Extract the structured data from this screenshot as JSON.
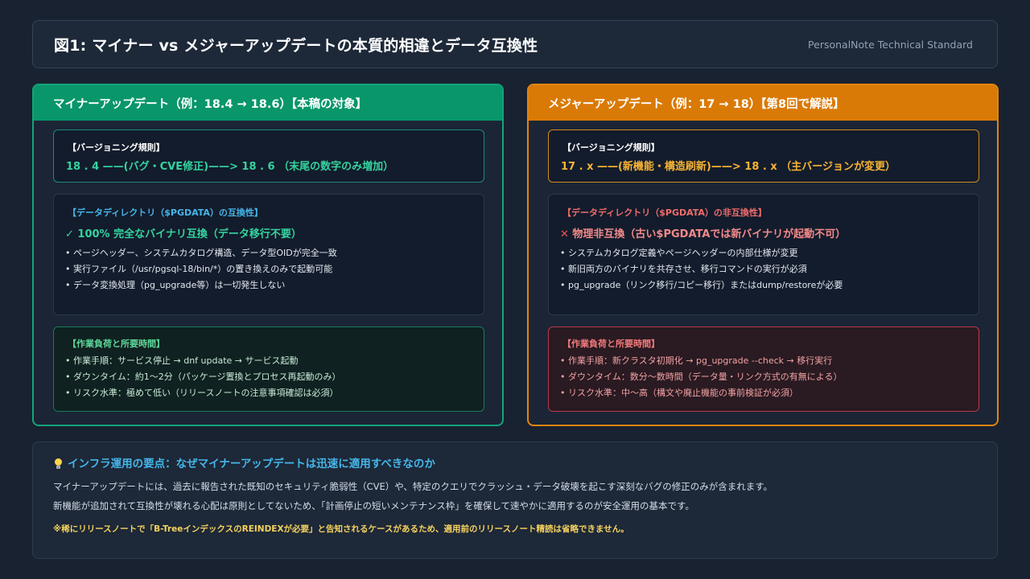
{
  "header": {
    "title": "図1: マイナー vs メジャーアップデートの本質的相違とデータ互換性",
    "subtitle": "PersonalNote Technical Standard"
  },
  "minor": {
    "heading": "マイナーアップデート（例：18.4 → 18.6）【本稿の対象】",
    "rule_label": "【バージョニング規則】",
    "rule_formula": "18 . 4 ——(バグ・CVE修正)——> 18 . 6 （末尾の数字のみ増加）",
    "compat_label": "【データディレクトリ（$PGDATA）の互換性】",
    "compat_verdict": "100% 完全なバイナリ互換（データ移行不要）",
    "compat_items": [
      "ページヘッダー、システムカタログ構造、データ型OIDが完全一致",
      "実行ファイル（/usr/pgsql-18/bin/*）の置き換えのみで起動可能",
      "データ変換処理（pg_upgrade等）は一切発生しない"
    ],
    "effort_label": "【作業負荷と所要時間】",
    "effort_items": [
      "作業手順：サービス停止 → dnf update → サービス起動",
      "ダウンタイム：約1〜2分（パッケージ置換とプロセス再起動のみ）",
      "リスク水準：極めて低い（リリースノートの注意事項確認は必須）"
    ]
  },
  "major": {
    "heading": "メジャーアップデート（例：17 → 18）【第8回で解説】",
    "rule_label": "【バージョニング規則】",
    "rule_formula": "17 . x ——(新機能・構造刷新)——> 18 . x （主バージョンが変更）",
    "compat_label": "【データディレクトリ（$PGDATA）の非互換性】",
    "compat_verdict": "物理非互換（古い$PGDATAでは新バイナリが起動不可）",
    "compat_items": [
      "システムカタログ定義やページヘッダーの内部仕様が変更",
      "新旧両方のバイナリを共存させ、移行コマンドの実行が必須",
      "pg_upgrade（リンク移行/コピー移行）またはdump/restoreが必要"
    ],
    "effort_label": "【作業負荷と所要時間】",
    "effort_items": [
      "作業手順：新クラスタ初期化 → pg_upgrade --check → 移行実行",
      "ダウンタイム：数分〜数時間（データ量・リンク方式の有無による）",
      "リスク水準：中〜高（構文や廃止機能の事前検証が必須）"
    ]
  },
  "footer": {
    "title": "インフラ運用の要点：なぜマイナーアップデートは迅速に適用すべきなのか",
    "line1": "マイナーアップデートには、過去に報告された既知のセキュリティ脆弱性（CVE）や、特定のクエリでクラッシュ・データ破壊を起こす深刻なバグの修正のみが含まれます。",
    "line2": "新機能が追加されて互換性が壊れる心配は原則としてないため、「計画停止の短いメンテナンス枠」を確保して速やかに適用するのが安全運用の基本です。",
    "note": "※稀にリリースノートで「B-TreeインデックスのREINDEXが必要」と告知されるケースがあるため、適用前のリリースノート精読は省略できません。"
  },
  "colors": {
    "minor_accent": "#08966a",
    "major_accent": "#da7a06",
    "background": "#192231"
  },
  "icons": {
    "check": "check-icon",
    "cross": "cross-icon",
    "bulb": "lightbulb-icon"
  }
}
